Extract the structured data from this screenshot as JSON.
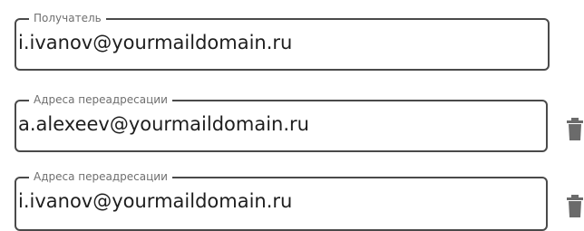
{
  "recipient": {
    "label": "Получатель",
    "value": "i.ivanov@yourmaildomain.ru"
  },
  "forwarding": [
    {
      "label": "Адреса переадресации",
      "value": "a.alexeev@yourmaildomain.ru",
      "action_icon": "trash-icon"
    },
    {
      "label": "Адреса переадресации",
      "value": "i.ivanov@yourmaildomain.ru",
      "action_icon": "trash-icon"
    }
  ],
  "colors": {
    "border": "#4a4a4a",
    "label": "#6f6f6f",
    "text": "#1e1e1e",
    "icon": "#6b6b6b"
  }
}
